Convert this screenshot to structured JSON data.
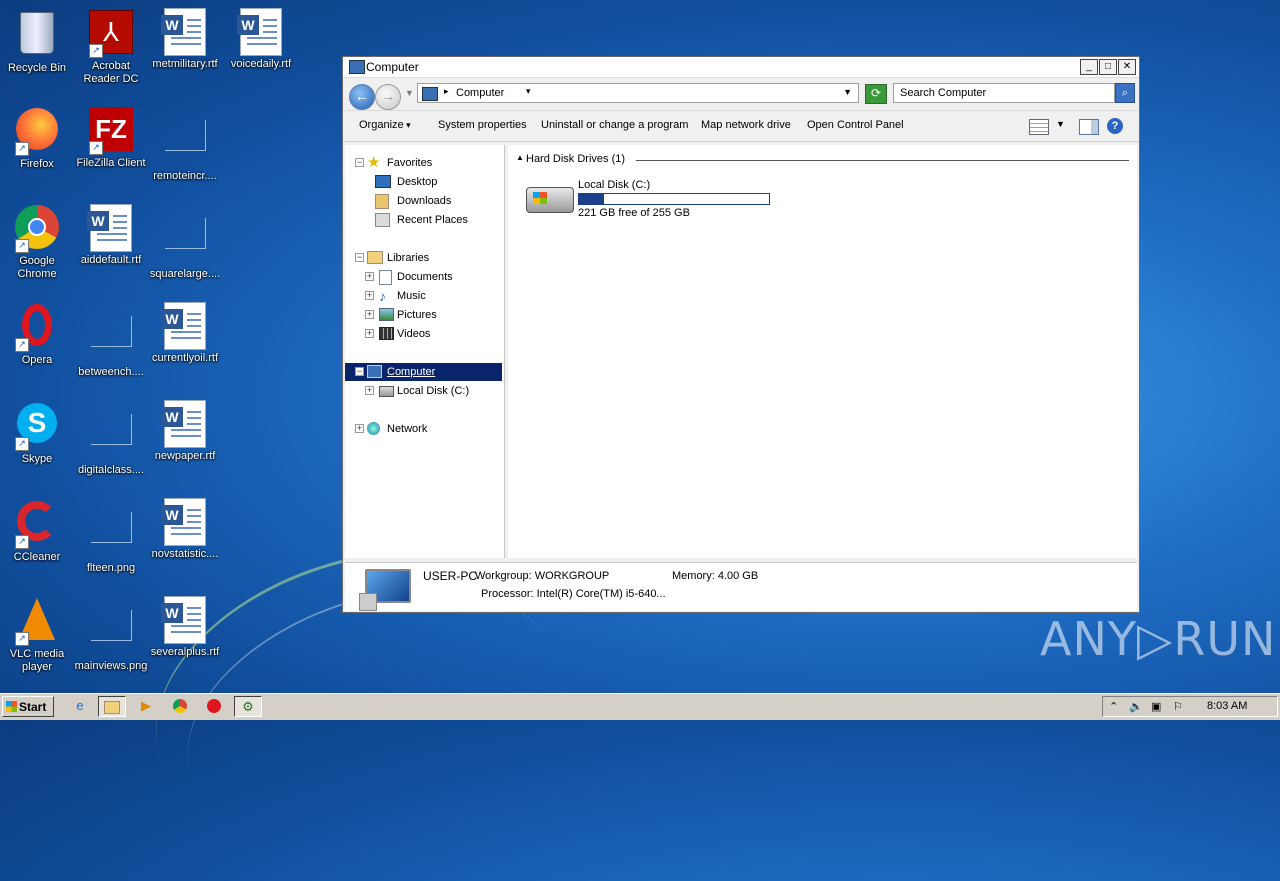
{
  "desktop": {
    "icons": [
      {
        "label": "Recycle Bin",
        "icon": "recycle-bin-icon"
      },
      {
        "label": "Acrobat Reader DC",
        "icon": "acrobat-icon"
      },
      {
        "label": "metmilitary.rtf",
        "icon": "word-document-icon"
      },
      {
        "label": "voicedaily.rtf",
        "icon": "word-document-icon"
      },
      {
        "label": "Firefox",
        "icon": "firefox-icon"
      },
      {
        "label": "FileZilla Client",
        "icon": "filezilla-icon"
      },
      {
        "label": "remoteincr....",
        "icon": "blank-file-icon"
      },
      {
        "label": "Google Chrome",
        "icon": "chrome-icon"
      },
      {
        "label": "aiddefault.rtf",
        "icon": "word-document-icon"
      },
      {
        "label": "squarelarge....",
        "icon": "blank-file-icon"
      },
      {
        "label": "Opera",
        "icon": "opera-icon"
      },
      {
        "label": "betweench....",
        "icon": "blank-file-icon"
      },
      {
        "label": "currentlyoil.rtf",
        "icon": "word-document-icon"
      },
      {
        "label": "Skype",
        "icon": "skype-icon"
      },
      {
        "label": "digitalclass....",
        "icon": "blank-file-icon"
      },
      {
        "label": "newpaper.rtf",
        "icon": "word-document-icon"
      },
      {
        "label": "CCleaner",
        "icon": "ccleaner-icon"
      },
      {
        "label": "flteen.png",
        "icon": "blank-file-icon"
      },
      {
        "label": "novstatistic....",
        "icon": "word-document-icon"
      },
      {
        "label": "VLC media player",
        "icon": "vlc-icon"
      },
      {
        "label": "mainviews.png",
        "icon": "blank-file-icon"
      },
      {
        "label": "severalplus.rtf",
        "icon": "word-document-icon"
      }
    ]
  },
  "window": {
    "title": "Computer",
    "address": {
      "path": "Computer"
    },
    "search": {
      "placeholder": "Search Computer"
    },
    "commands": {
      "organize": "Organize",
      "system_properties": "System properties",
      "uninstall": "Uninstall or change a program",
      "map_drive": "Map network drive",
      "control_panel": "Open Control Panel"
    },
    "nav": {
      "favorites": "Favorites",
      "desktop": "Desktop",
      "downloads": "Downloads",
      "recent": "Recent Places",
      "libraries": "Libraries",
      "documents": "Documents",
      "music": "Music",
      "pictures": "Pictures",
      "videos": "Videos",
      "computer": "Computer",
      "local_disk": "Local Disk (C:)",
      "network": "Network"
    },
    "content": {
      "group_header": "Hard Disk Drives (1)",
      "drive_name": "Local Disk (C:)",
      "drive_used_fraction": 0.133,
      "drive_free": "221 GB free of 255 GB"
    },
    "details": {
      "pc_name": "USER-PC",
      "workgroup": "Workgroup: WORKGROUP",
      "memory": "Memory: 4.00 GB",
      "processor": "Processor: Intel(R) Core(TM) i5-640..."
    }
  },
  "watermark": "ANY▷RUN",
  "taskbar": {
    "start_label": "Start",
    "apps": [
      "ie-icon",
      "explorer-icon",
      "media-player-icon",
      "chrome-icon",
      "opera-icon",
      "tool-icon"
    ],
    "clock": "8:03 AM"
  }
}
